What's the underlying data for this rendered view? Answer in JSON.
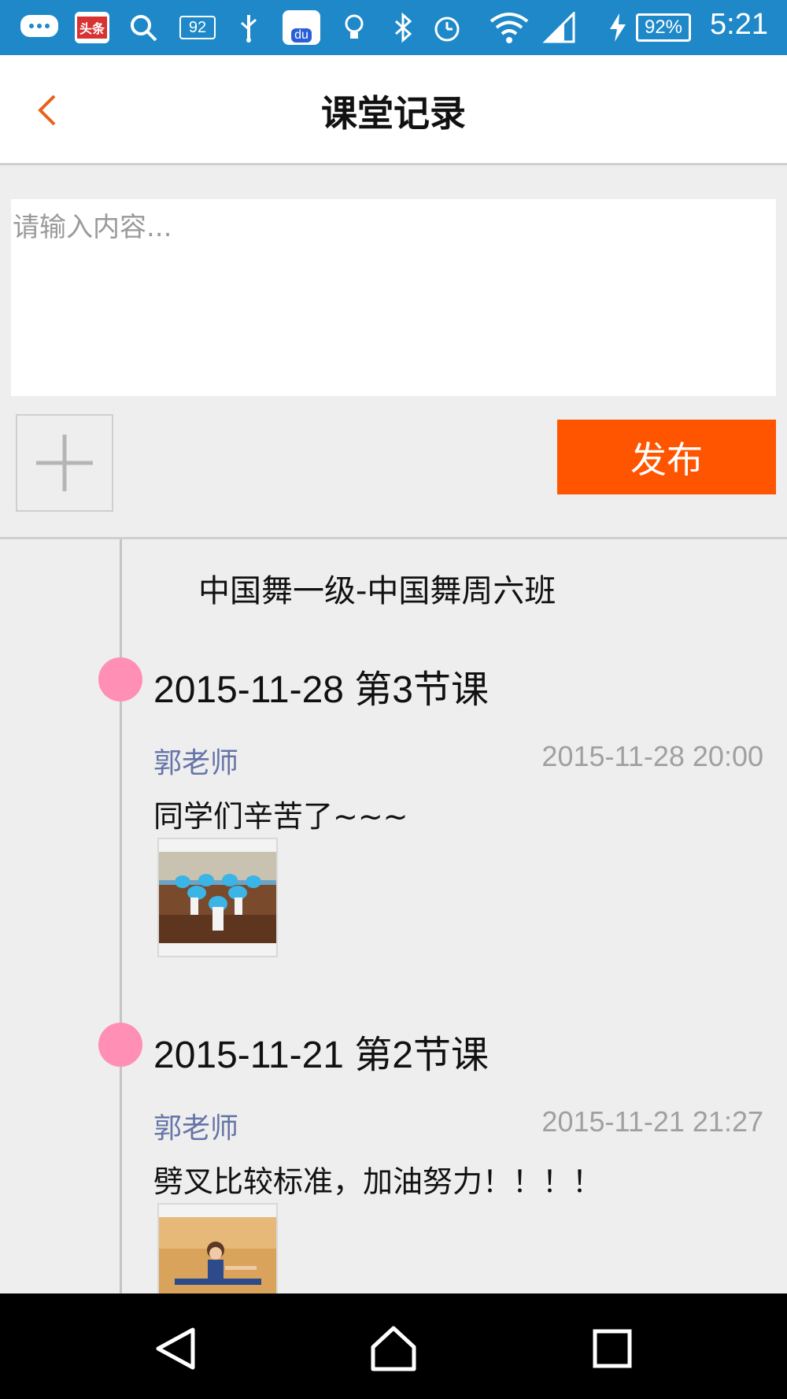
{
  "status_bar": {
    "notification_badge": "头条",
    "sim_label": "92",
    "baidu_label": "du",
    "battery": "92%",
    "time": "5:21"
  },
  "header": {
    "title": "课堂记录",
    "accent_color": "#e8611a"
  },
  "composer": {
    "placeholder": "请输入内容...",
    "value": "",
    "publish_label": "发布",
    "publish_color": "#ff5500"
  },
  "timeline": {
    "class_name": "中国舞一级-中国舞周六班",
    "entries": [
      {
        "lesson": "2015-11-28 第3节课",
        "teacher": "郭老师",
        "timestamp": "2015-11-28 20:00",
        "content": "同学们辛苦了~~~"
      },
      {
        "lesson": "2015-11-21 第2节课",
        "teacher": "郭老师",
        "timestamp": "2015-11-21 21:27",
        "content": "劈叉比较标准，加油努力！！！！"
      }
    ],
    "dot_color": "#ff8fb4"
  },
  "navbar": {
    "icons": [
      "back-triangle-icon",
      "home-icon",
      "recents-icon"
    ]
  }
}
